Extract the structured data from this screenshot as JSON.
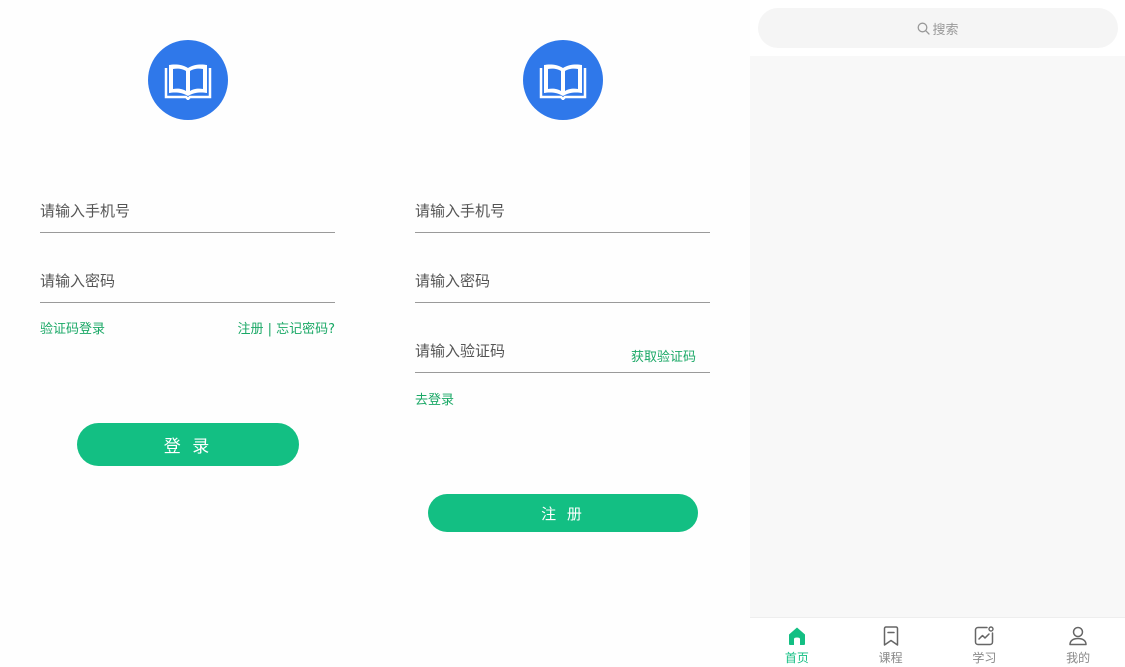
{
  "login": {
    "phone_placeholder": "请输入手机号",
    "password_placeholder": "请输入密码",
    "code_login_link": "验证码登录",
    "register_forgot_link": "注册 | 忘记密码?",
    "submit_label": "登 录"
  },
  "register": {
    "phone_placeholder": "请输入手机号",
    "password_placeholder": "请输入密码",
    "code_placeholder": "请输入验证码",
    "get_code_link": "获取验证码",
    "go_login_link": "去登录",
    "submit_label": "注 册"
  },
  "home": {
    "search_placeholder": "搜索",
    "tabs": [
      {
        "label": "首页",
        "icon": "home-icon",
        "active": true
      },
      {
        "label": "课程",
        "icon": "bookmark-icon",
        "active": false
      },
      {
        "label": "学习",
        "icon": "chart-icon",
        "active": false
      },
      {
        "label": "我的",
        "icon": "user-icon",
        "active": false
      }
    ]
  },
  "colors": {
    "logo_blue": "#2f78ea",
    "accent_green": "#13bf83",
    "link_green": "#1aa866"
  }
}
